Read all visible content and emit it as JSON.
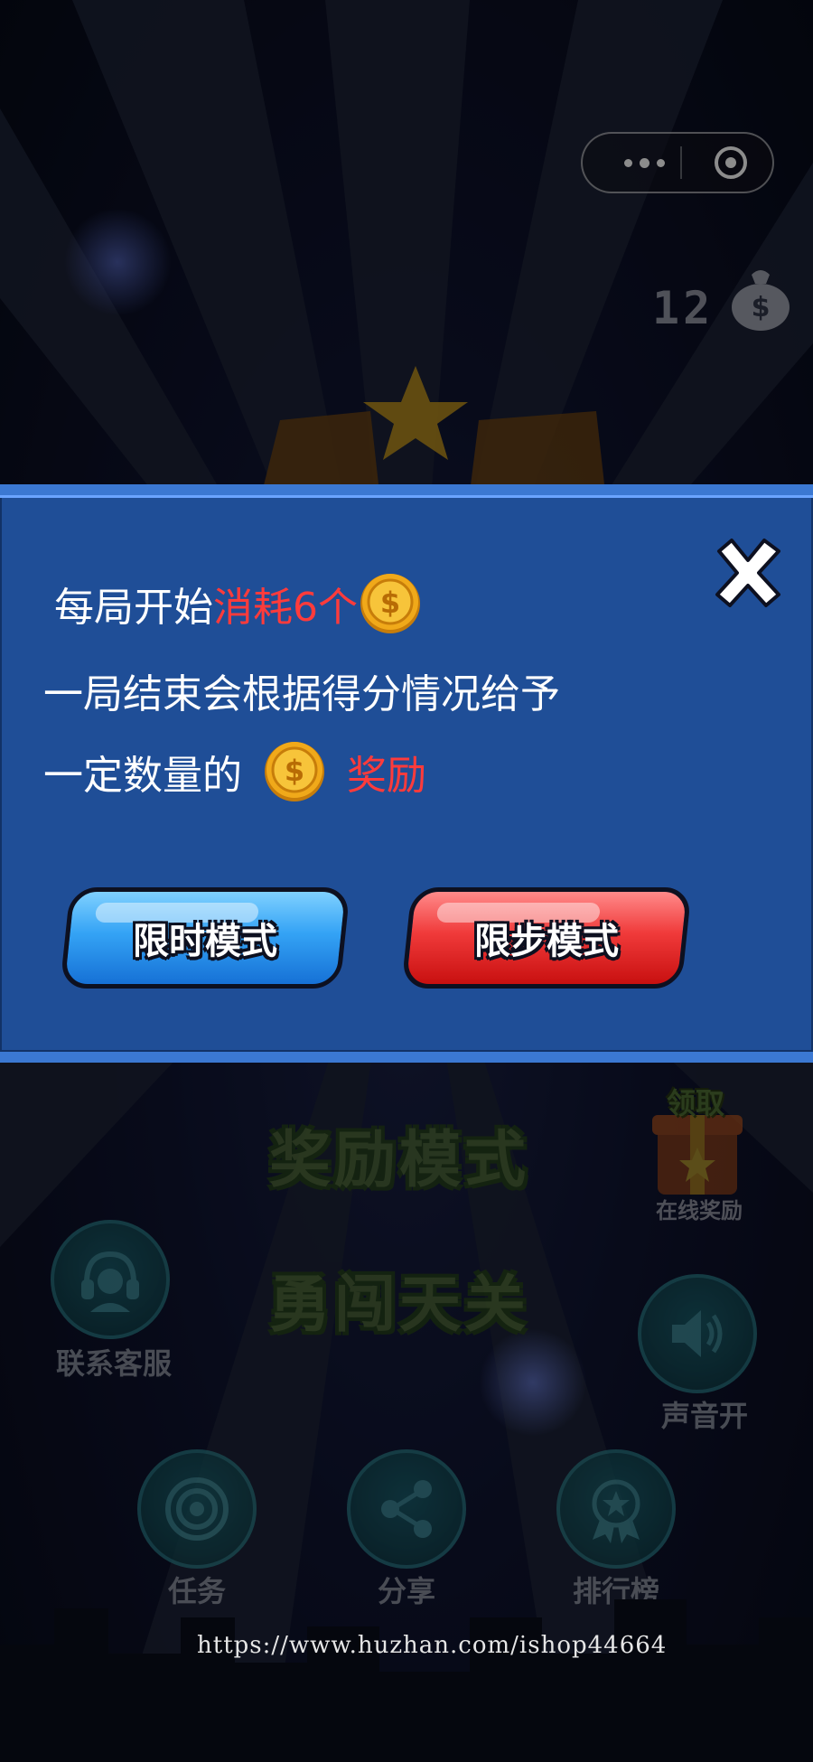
{
  "topbar": {
    "more_icon": "more-dots-icon",
    "close_icon": "target-circle-icon"
  },
  "currency": {
    "count": "12",
    "icon": "money-bag-icon"
  },
  "dialog": {
    "line1_prefix": "每局开始",
    "line1_highlight": "消耗6个",
    "line2": "一局结束会根据得分情况给予",
    "line3_prefix": "一定数量的",
    "line3_highlight": "奖励",
    "coin_icon": "gold-coin-icon",
    "close_icon": "close-x-icon",
    "buttons": {
      "timed": "限时模式",
      "steps": "限步模式"
    },
    "colors": {
      "panel": "#1f4e97",
      "highlight": "#ff3b3b",
      "timed_button": "#34a3f5",
      "steps_button": "#f03a3a"
    }
  },
  "menu": {
    "reward_mode": "奖励模式",
    "challenge_mode": "勇闯天关",
    "online_reward_top": "领取",
    "online_reward": "在线奖励",
    "customer_service": "联系客服",
    "sound": "声音开",
    "tasks": "任务",
    "share": "分享",
    "leaderboard": "排行榜"
  },
  "watermark": "https://www.huzhan.com/ishop44664"
}
